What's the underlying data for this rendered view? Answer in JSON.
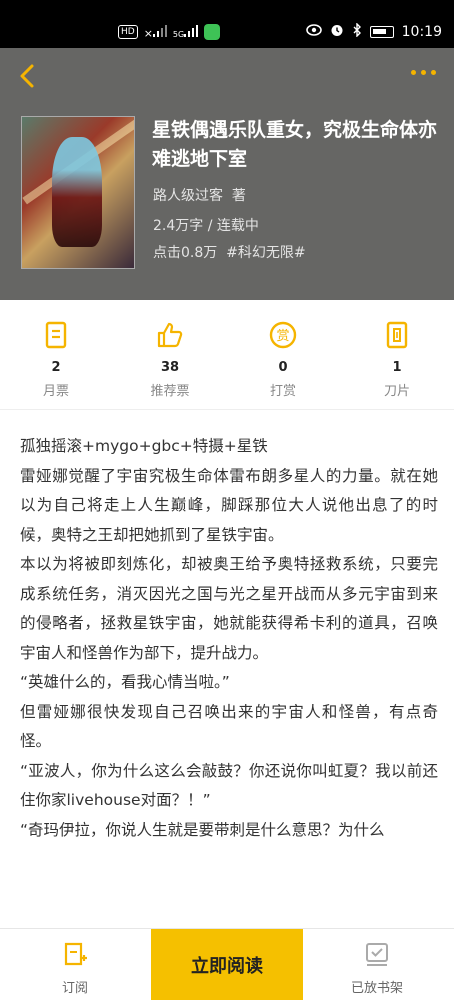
{
  "status_bar": {
    "hd_label": "HD",
    "sim1": "×",
    "sim2": "5G",
    "time": "10:19"
  },
  "book": {
    "title": "星铁偶遇乐队重女，究极生命体亦难逃地下室",
    "author": "路人级过客",
    "author_suffix": "著",
    "length_status": "2.4万字 / 连载中",
    "clicks": "点击0.8万",
    "tag": "#科幻无限#"
  },
  "stats": [
    {
      "icon": "monthly-ticket-icon",
      "value": "2",
      "label": "月票"
    },
    {
      "icon": "thumbs-up-icon",
      "value": "38",
      "label": "推荐票"
    },
    {
      "icon": "reward-coin-icon",
      "value": "0",
      "label": "打赏"
    },
    {
      "icon": "blade-icon",
      "value": "1",
      "label": "刀片"
    }
  ],
  "description": [
    "孤独摇滚+mygo+gbc+特摄+星铁",
    "雷娅娜觉醒了宇宙究极生命体雷布朗多星人的力量。就在她以为自己将走上人生巅峰，脚踩那位大人说他出息了的时候，奥特之王却把她抓到了星铁宇宙。",
    "本以为将被即刻炼化，却被奥王给予奥特拯救系统，只要完成系统任务，消灭因光之国与光之星开战而从多元宇宙到来的侵略者，拯救星铁宇宙，她就能获得希卡利的道具，召唤宇宙人和怪兽作为部下，提升战力。",
    "“英雄什么的，看我心情当啦。”",
    "但雷娅娜很快发现自己召唤出来的宇宙人和怪兽，有点奇怪。",
    "“亚波人，你为什么这么会敲鼓？你还说你叫虹夏？我以前还住你家livehouse对面？！”",
    "“奇玛伊拉，你说人生就是要带刺是什么意思？为什么"
  ],
  "bottom_bar": {
    "subscribe_label": "订阅",
    "read_label": "立即阅读",
    "shelf_label": "已放书架"
  },
  "colors": {
    "accent": "#f5c000",
    "hero_bg": "#666664"
  }
}
